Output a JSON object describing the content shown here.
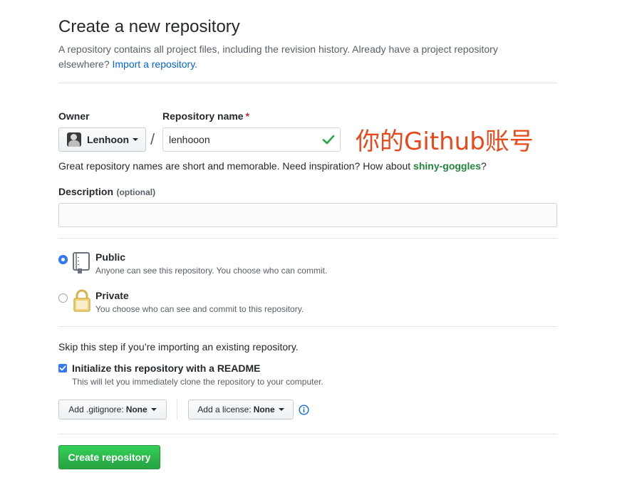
{
  "header": {
    "title": "Create a new repository",
    "subtitle_before": "A repository contains all project files, including the revision history. Already have a project repository elsewhere? ",
    "import_link": "Import a repository",
    "subtitle_after": "."
  },
  "owner": {
    "label": "Owner",
    "value": "Lenhoon"
  },
  "repo": {
    "label": "Repository name",
    "required_mark": "*",
    "value": "lenhooon",
    "slash": "/"
  },
  "annotation": "你的Github账号",
  "hint": {
    "before": "Great repository names are short and memorable. Need inspiration? How about ",
    "suggestion": "shiny-goggles",
    "after": "?"
  },
  "description": {
    "label": "Description",
    "optional": "(optional)",
    "value": "",
    "placeholder": ""
  },
  "visibility": {
    "selected": "public",
    "public": {
      "title": "Public",
      "desc": "Anyone can see this repository. You choose who can commit."
    },
    "private": {
      "title": "Private",
      "desc": "You choose who can see and commit to this repository."
    }
  },
  "init": {
    "skip_text": "Skip this step if you’re importing an existing repository.",
    "readme_label": "Initialize this repository with a README",
    "readme_checked": true,
    "readme_desc": "This will let you immediately clone the repository to your computer."
  },
  "gitignore": {
    "label": "Add .gitignore:",
    "value": "None"
  },
  "license": {
    "label": "Add a license:",
    "value": "None"
  },
  "submit": {
    "label": "Create repository"
  },
  "colors": {
    "link": "#0366d6",
    "success": "#28a745",
    "suggestion": "#22863a",
    "annotation": "#e8481a",
    "radio_checked": "#3478f6"
  },
  "icons": [
    "check-icon",
    "book-icon",
    "lock-icon",
    "info-icon",
    "caret-down-icon",
    "avatar"
  ]
}
